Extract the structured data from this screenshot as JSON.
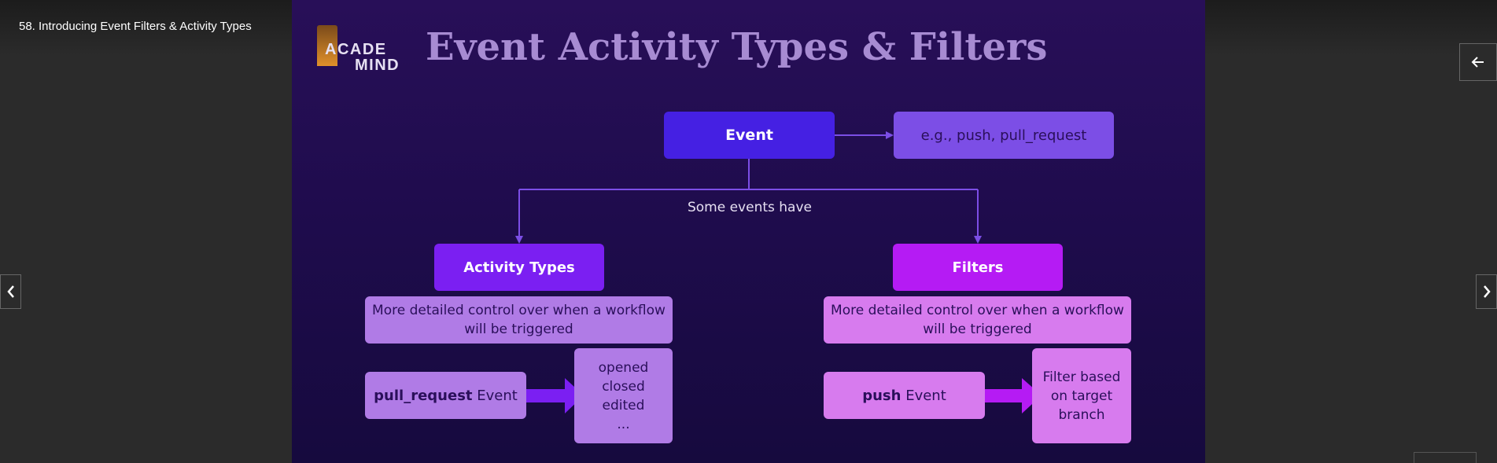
{
  "lecture": {
    "title": "58. Introducing Event Filters & Activity Types"
  },
  "slide": {
    "logo": {
      "line1": "ACADE",
      "line2": "MIND"
    },
    "title": "Event Activity Types & Filters",
    "event": "Event",
    "event_example": "e.g., push, pull_request",
    "some_events": "Some events have",
    "activity_types": {
      "label": "Activity Types",
      "description": "More detailed control over when a workflow will be triggered",
      "event_bold": "pull_request",
      "event_suffix": " Event",
      "values": [
        "opened",
        "closed",
        "edited",
        "..."
      ]
    },
    "filters": {
      "label": "Filters",
      "description": "More detailed control over when a workflow will be triggered",
      "event_bold": "push",
      "event_suffix": " Event",
      "filter_text": "Filter based on target branch"
    }
  },
  "colors": {
    "slide_background": "#1f0c4d",
    "title": "#a78bd2",
    "event": "#4520e3",
    "activity_types": "#7b1ff2",
    "filters": "#b51bf4",
    "connector": "#7c4ee6",
    "arrow": "#7b1ff2"
  },
  "icons": {
    "previous": "chevron-left-icon",
    "next": "chevron-right-icon",
    "back": "arrow-left-icon"
  }
}
